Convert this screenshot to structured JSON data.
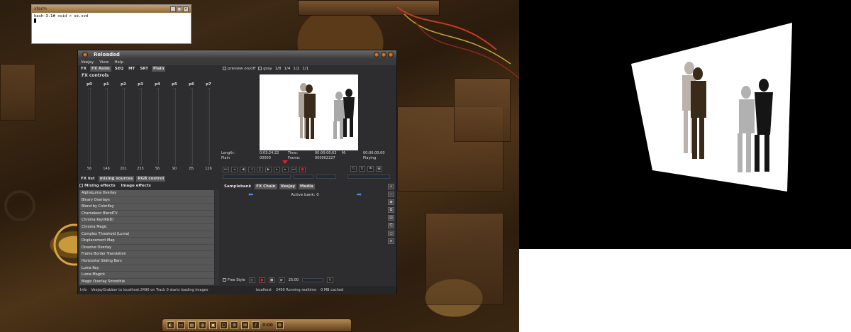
{
  "xterm": {
    "title": "xterm",
    "prompt": "bash-3.1# xvid > se.xvd"
  },
  "window": {
    "title": "Reloaded",
    "menu": [
      "Veejay",
      "View",
      "Help"
    ],
    "tabs": [
      "FX",
      "FX Anim",
      "SEQ",
      "MT",
      "SRT",
      "Plain"
    ],
    "fx_controls_label": "FX controls",
    "params": [
      {
        "name": "p0",
        "value": "56"
      },
      {
        "name": "p1",
        "value": "146"
      },
      {
        "name": "p2",
        "value": "201"
      },
      {
        "name": "p3",
        "value": "255"
      },
      {
        "name": "p4",
        "value": "56"
      },
      {
        "name": "p5",
        "value": "90"
      },
      {
        "name": "p6",
        "value": "85"
      },
      {
        "name": "p7",
        "value": "126"
      }
    ],
    "preview_label": "preview on/off",
    "zoom": [
      "gray",
      "1/8",
      "1/4",
      "1/2",
      "1/1"
    ],
    "info": {
      "length_label": "Length:",
      "length_value": "0:03:24:22",
      "time_label": "Time:",
      "time_value": "00:00:00:02",
      "m_label": "M:",
      "m_value": "00:00:00:00",
      "plain_label": "Plain",
      "plain_value": "00000",
      "frame_label": "Frame:",
      "frame_value": "000002227",
      "state_label": "Playing"
    },
    "source_tabs": [
      "FX list",
      "mixing sources",
      "RGB control"
    ],
    "effect_tabs": [
      "Mixing effects",
      "Image effects"
    ],
    "fx_list": [
      "AlphaLuma Overlay",
      "Binary Overlays",
      "Blend by ColorKey",
      "Chameleon BlendTV",
      "Chroma Key(RGB)",
      "Chroma Magic",
      "Complex Threshold (Luma)",
      "Displacement Map",
      "Dissolve Overlay",
      "Frame Border Translation",
      "Horizontal Sliding Bars",
      "Luma Key",
      "Luma Magick",
      "Magic Overlay Smoothie"
    ],
    "sample_tabs": [
      "Samplebank",
      "FX Chain",
      "Veejay",
      "Media"
    ],
    "active_bank_label": "Active bank:",
    "active_bank_value": "0",
    "free_style_label": "Free Style",
    "fps_value": "25.00",
    "status": {
      "label": "Info",
      "message": "VeejayGrabber to localhost:3490 on Track 0 starts loading images",
      "host": "localhost",
      "port_status": "3490  Running realtime",
      "cache": "0 MB cached"
    }
  },
  "taskbar": {
    "clock": "0:00"
  },
  "colors": {
    "window_bg": "#2d2d2f",
    "list_bg": "#575757",
    "accent_red": "#e02020",
    "arrow_blue": "#4a8ae0"
  }
}
